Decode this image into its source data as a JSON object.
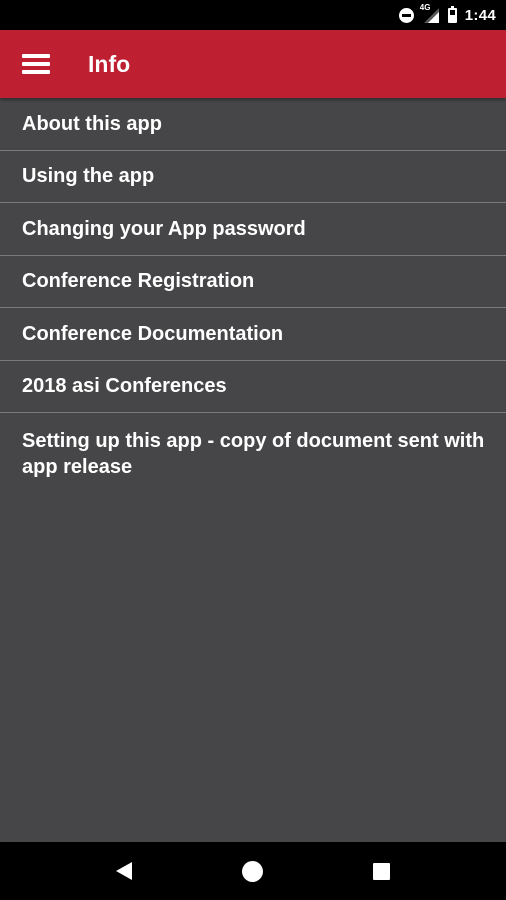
{
  "status_bar": {
    "network": "4G",
    "time": "1:44",
    "icons": [
      "do-not-disturb-icon",
      "signal-icon",
      "battery-icon"
    ]
  },
  "app_bar": {
    "title": "Info",
    "menu_icon": "hamburger-menu-icon",
    "color": "#be1f31"
  },
  "list": {
    "items": [
      {
        "label": "About this app"
      },
      {
        "label": "Using the app"
      },
      {
        "label": "Changing your App password"
      },
      {
        "label": "Conference Registration"
      },
      {
        "label": "Conference Documentation"
      },
      {
        "label": "2018 asi Conferences"
      },
      {
        "label": "Setting up this app - copy of document sent with app release"
      }
    ]
  },
  "nav_bar": {
    "icons": [
      "back-icon",
      "home-icon",
      "recents-icon"
    ]
  }
}
